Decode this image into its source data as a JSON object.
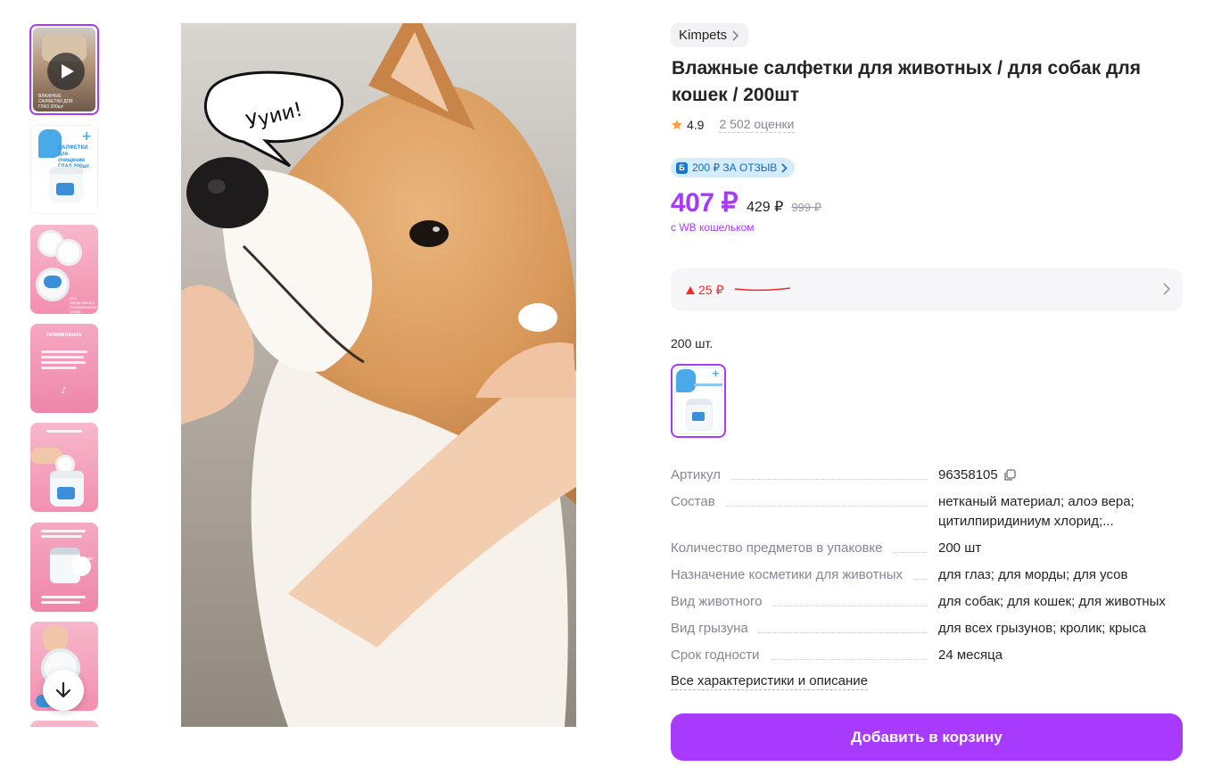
{
  "gallery": {
    "thumbnails": [
      {
        "kind": "video",
        "caption": "ВЛАЖНЫЕ САЛФЕТКИ ДЛЯ ГЛАЗ 200шт"
      },
      {
        "kind": "product",
        "caption": "САЛФЕТКИ для очищения ГЛАЗ 200шт"
      },
      {
        "kind": "pads",
        "caption": "для ежедневного гигиенического ухода"
      },
      {
        "kind": "text",
        "caption": "ПРИМЕНЕНИЕ"
      },
      {
        "kind": "hand",
        "caption": ""
      },
      {
        "kind": "jar",
        "caption": "200шт"
      },
      {
        "kind": "hand-jar",
        "caption": ""
      }
    ],
    "speech_bubble": "Ууии!",
    "scroll_down_icon": "arrow-down-icon",
    "play_icon": "play-icon"
  },
  "product": {
    "brand": "Kimpets",
    "title": "Влажные салфетки для животных / для собак для кошек / 200шт",
    "rating": "4.9",
    "reviews_count": "2 502 оценки",
    "promo_icon": "Б",
    "promo_text": "200 ₽ ЗА ОТЗЫВ",
    "price_wallet": "407 ₽",
    "price_regular": "429 ₽",
    "price_old": "999 ₽",
    "wallet_note": "с WB кошельком",
    "price_change": "25 ₽",
    "variant_label": "200 шт.",
    "specs": [
      {
        "name": "Артикул",
        "value": "96358105"
      },
      {
        "name": "Состав",
        "value": "нетканый материал; алоэ вера;",
        "value2": "цитилпиридиниум хлорид;..."
      },
      {
        "name": "Количество предметов в упаковке",
        "value": "200 шт"
      },
      {
        "name": "Назначение косметики для животных",
        "value": "для глаз; для морды; для усов"
      },
      {
        "name": "Вид животного",
        "value": "для собак; для кошек; для животных"
      },
      {
        "name": "Вид грызуна",
        "value": "для всех грызунов; кролик; крыса"
      },
      {
        "name": "Срок годности",
        "value": "24 месяца"
      }
    ],
    "all_characteristics": "Все характеристики и описание",
    "add_to_cart": "Добавить в корзину"
  },
  "colors": {
    "accent": "#a73afd",
    "price_up": "#f12b2b",
    "star": "#ff9e3d",
    "muted": "#868695"
  }
}
